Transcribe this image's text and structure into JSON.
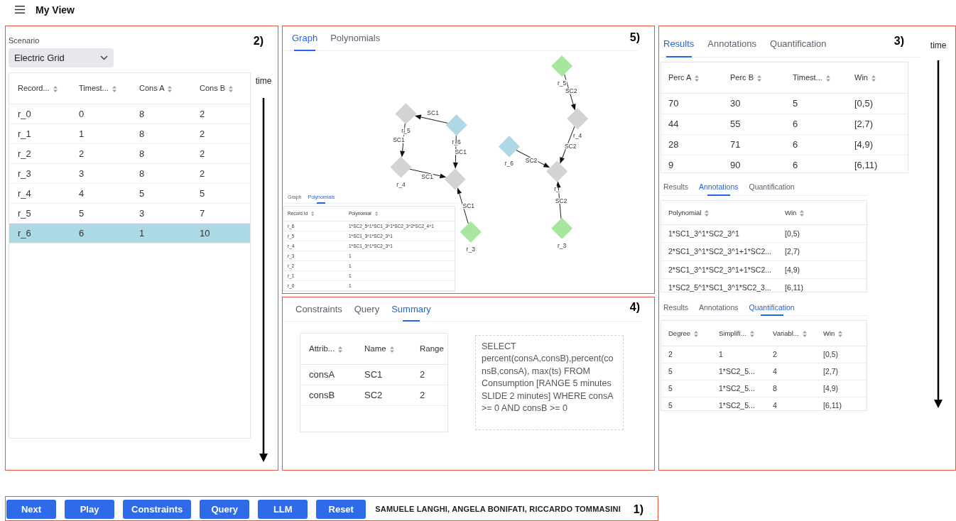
{
  "header": {
    "title": "My View"
  },
  "scenario_panel": {
    "marker": "2)",
    "scenario_label": "Scenario",
    "scenario": "Electric Grid",
    "time_label": "time",
    "table": {
      "columns": [
        {
          "label": "Record...",
          "sortable": true
        },
        {
          "label": "Timest...",
          "sortable": true
        },
        {
          "label": "Cons A",
          "sortable": true
        },
        {
          "label": "Cons B",
          "sortable": true
        }
      ],
      "rows": [
        {
          "cells": [
            "r_0",
            "0",
            "8",
            "2"
          ],
          "selected": false
        },
        {
          "cells": [
            "r_1",
            "1",
            "8",
            "2"
          ],
          "selected": false
        },
        {
          "cells": [
            "r_2",
            "2",
            "8",
            "2"
          ],
          "selected": false
        },
        {
          "cells": [
            "r_3",
            "3",
            "8",
            "2"
          ],
          "selected": false
        },
        {
          "cells": [
            "r_4",
            "4",
            "5",
            "5"
          ],
          "selected": false
        },
        {
          "cells": [
            "r_5",
            "5",
            "3",
            "7"
          ],
          "selected": false
        },
        {
          "cells": [
            "r_6",
            "6",
            "1",
            "10"
          ],
          "selected": true
        }
      ]
    }
  },
  "graph_panel": {
    "marker": "5)",
    "tabs": [
      {
        "label": "Graph",
        "selected": true
      },
      {
        "label": "Polynomials",
        "selected": false
      }
    ],
    "graph": {
      "nodes": [
        {
          "label": "r_5",
          "color": "#d3d3d3"
        },
        {
          "label": "r_6",
          "color": "#add8e6"
        },
        {
          "label": "r_4",
          "color": "#d3d3d3"
        },
        {
          "color": "#d3d3d3"
        },
        {
          "label": "r_3",
          "color": "#a8e6a0"
        },
        {
          "label": "r_5",
          "color": "#a8e6a0"
        },
        {
          "label": "r_4",
          "color": "#d3d3d3"
        },
        {
          "label": "r_6",
          "color": "#add8e6"
        },
        {
          "label": "r_",
          "color": "#d3d3d3"
        },
        {
          "label": "r_3",
          "color": "#a8e6a0"
        }
      ],
      "edges": [
        {
          "label": "SC1"
        },
        {
          "label": "SC1"
        },
        {
          "label": "SC1"
        },
        {
          "label": "SC1"
        },
        {
          "label": "SC1"
        },
        {
          "label": "SC2"
        },
        {
          "label": "SC2"
        },
        {
          "label": "SC2"
        },
        {
          "label": "SC2"
        }
      ]
    },
    "inset": {
      "tabs": [
        {
          "label": "Graph",
          "selected": false
        },
        {
          "label": "Polynomials",
          "selected": true
        }
      ],
      "columns": [
        {
          "label": "Record Id",
          "sortable": true
        },
        {
          "label": "Polynomial",
          "sortable": true
        }
      ],
      "rows": [
        [
          "r_6",
          "1*SC2_5^1*SC1_3^1*SC2_3^2*SC2_4^1"
        ],
        [
          "r_5",
          "1*SC1_3^1*SC2_3^1"
        ],
        [
          "r_4",
          "1*SC1_3^1*SC2_3^1"
        ],
        [
          "r_3",
          "1"
        ],
        [
          "r_2",
          "1"
        ],
        [
          "r_1",
          "1"
        ],
        [
          "r_0",
          "1"
        ]
      ]
    }
  },
  "summary_panel": {
    "marker": "4)",
    "tabs": [
      {
        "label": "Constraints",
        "selected": false
      },
      {
        "label": "Query",
        "selected": false
      },
      {
        "label": "Summary",
        "selected": true
      }
    ],
    "table": {
      "columns": [
        {
          "label": "Attrib...",
          "sortable": true
        },
        {
          "label": "Name",
          "sortable": true
        },
        {
          "label": "Range",
          "sortable": false
        }
      ],
      "rows": [
        [
          "consA",
          "SC1",
          "2"
        ],
        [
          "consB",
          "SC2",
          "2"
        ]
      ]
    },
    "query": "SELECT percent(consA,consB),percent(consB,consA), max(ts) FROM Consumption [RANGE 5 minutes SLIDE 2 minutes] WHERE consA >= 0 AND consB >= 0"
  },
  "results_panel": {
    "marker": "3)",
    "time_label": "time",
    "sections": [
      {
        "tabs": [
          {
            "label": "Results",
            "selected": true
          },
          {
            "label": "Annotations",
            "selected": false
          },
          {
            "label": "Quantification",
            "selected": false
          }
        ],
        "columns": [
          {
            "label": "Perc A",
            "sortable": true
          },
          {
            "label": "Perc B",
            "sortable": true
          },
          {
            "label": "Timest...",
            "sortable": true
          },
          {
            "label": "Win",
            "sortable": true
          }
        ],
        "rows": [
          [
            "70",
            "30",
            "5",
            "[0,5)"
          ],
          [
            "44",
            "55",
            "6",
            "[2,7)"
          ],
          [
            "28",
            "71",
            "6",
            "[4,9)"
          ],
          [
            "9",
            "90",
            "6",
            "[6,11)"
          ]
        ]
      },
      {
        "tabs": [
          {
            "label": "Results",
            "selected": false
          },
          {
            "label": "Annotations",
            "selected": true
          },
          {
            "label": "Quantification",
            "selected": false
          }
        ],
        "columns": [
          {
            "label": "Polynomial",
            "sortable": true
          },
          {
            "label": "Win",
            "sortable": true
          }
        ],
        "rows": [
          [
            "1*SC1_3^1*SC2_3^1",
            "[0,5)"
          ],
          [
            "2*SC1_3^1*SC2_3^1+1*SC2...",
            "[2,7)"
          ],
          [
            "2*SC1_3^1*SC2_3^1+1*SC2...",
            "[4,9)"
          ],
          [
            "1*SC2_5^1*SC1_3^1*SC2_3...",
            "[6,11)"
          ]
        ]
      },
      {
        "tabs": [
          {
            "label": "Results",
            "selected": false
          },
          {
            "label": "Annotations",
            "selected": false
          },
          {
            "label": "Quantification",
            "selected": true
          }
        ],
        "columns": [
          {
            "label": "Degree",
            "sortable": true
          },
          {
            "label": "Simplifi...",
            "sortable": true
          },
          {
            "label": "Variabl...",
            "sortable": true
          },
          {
            "label": "Win",
            "sortable": true
          }
        ],
        "rows": [
          [
            "2",
            "1",
            "2",
            "[0,5)"
          ],
          [
            "5",
            "1*SC2_5...",
            "4",
            "[2,7)"
          ],
          [
            "5",
            "1*SC2_5...",
            "8",
            "[4,9)"
          ],
          [
            "5",
            "1*SC2_5...",
            "4",
            "[6,11)"
          ]
        ]
      }
    ]
  },
  "footer": {
    "buttons": [
      "Next",
      "Play",
      "Constraints",
      "Query",
      "LLM",
      "Reset"
    ],
    "authors": "SAMUELE LANGHI, ANGELA BONIFATI, RICCARDO TOMMASINI",
    "marker": "1)"
  }
}
